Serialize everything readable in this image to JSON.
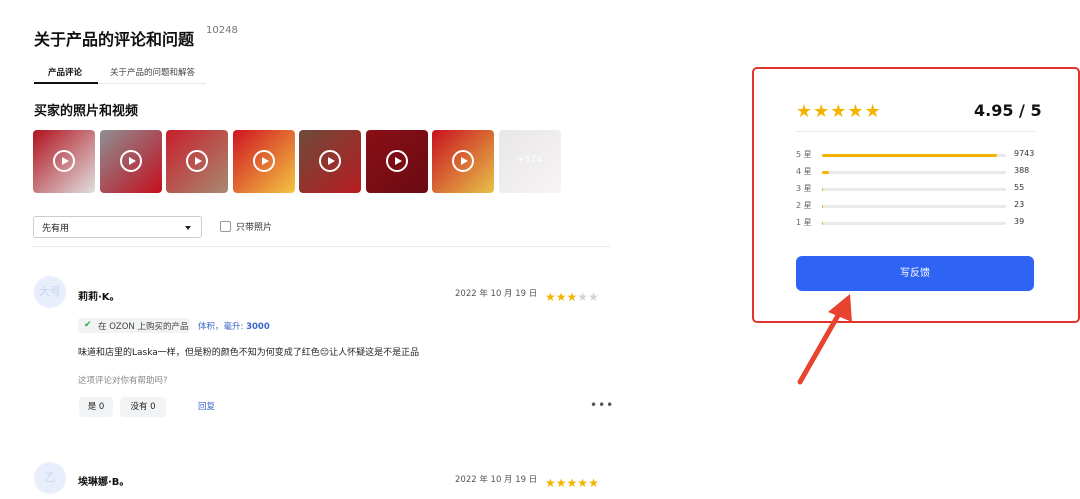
{
  "page": {
    "title": "关于产品的评论和问题",
    "title_count": "10248"
  },
  "tabs": [
    {
      "label": "产品评论",
      "active": true
    },
    {
      "label": "关于产品的问题和解答",
      "active": false
    }
  ],
  "media": {
    "section_title": "买家的照片和视频",
    "thumbnails": [
      {
        "type": "video",
        "colors": [
          "#b0121e",
          "#e0e0e0"
        ]
      },
      {
        "type": "video",
        "colors": [
          "#8d8f94",
          "#c30f1d"
        ]
      },
      {
        "type": "video",
        "colors": [
          "#c81e2b",
          "#a88a72"
        ]
      },
      {
        "type": "video",
        "colors": [
          "#cf1422",
          "#f4c542"
        ]
      },
      {
        "type": "video",
        "colors": [
          "#6d4b3a",
          "#b81c22"
        ]
      },
      {
        "type": "video",
        "colors": [
          "#8b0f17",
          "#6a0b12"
        ]
      },
      {
        "type": "video",
        "colors": [
          "#c8121f",
          "#e8c24a"
        ]
      }
    ],
    "more_label": "+574"
  },
  "filters": {
    "sort_value": "先有用",
    "photo_only_label": "只带照片",
    "photo_only_checked": false
  },
  "reviews": [
    {
      "avatar_text": "大号",
      "name": "莉莉·K。",
      "date": "2022 年 10 月 19 日",
      "rating": 3,
      "verified_label": "在 OZON 上购买的产品",
      "attr_label": "体积，毫升:",
      "attr_value": "3000",
      "text": "味道和店里的Laska一样，但是粉的颜色不知为何变成了红色😔让人怀疑这是不是正品",
      "helpful_question": "这项评论对你有帮助吗?",
      "yes_label": "是 0",
      "no_label": "没有 0",
      "reply_label": "回复"
    },
    {
      "avatar_text": "乙",
      "name": "埃琳娜·B。",
      "date": "2022 年 10 月 19 日",
      "rating": 5
    }
  ],
  "summary": {
    "rating_stars": 5,
    "score": "4.95 / 5",
    "distribution": [
      {
        "label": "5 星",
        "count": "9743",
        "fraction": 0.95
      },
      {
        "label": "4 星",
        "count": "388",
        "fraction": 0.04
      },
      {
        "label": "3 星",
        "count": "55",
        "fraction": 0.006
      },
      {
        "label": "2 星",
        "count": "23",
        "fraction": 0.003
      },
      {
        "label": "1 星",
        "count": "39",
        "fraction": 0.004
      }
    ],
    "feedback_button": "写反馈"
  },
  "colors": {
    "accent_blue": "#2f63f3",
    "star_gold": "#f3b400",
    "highlight_red": "#e0332b"
  }
}
